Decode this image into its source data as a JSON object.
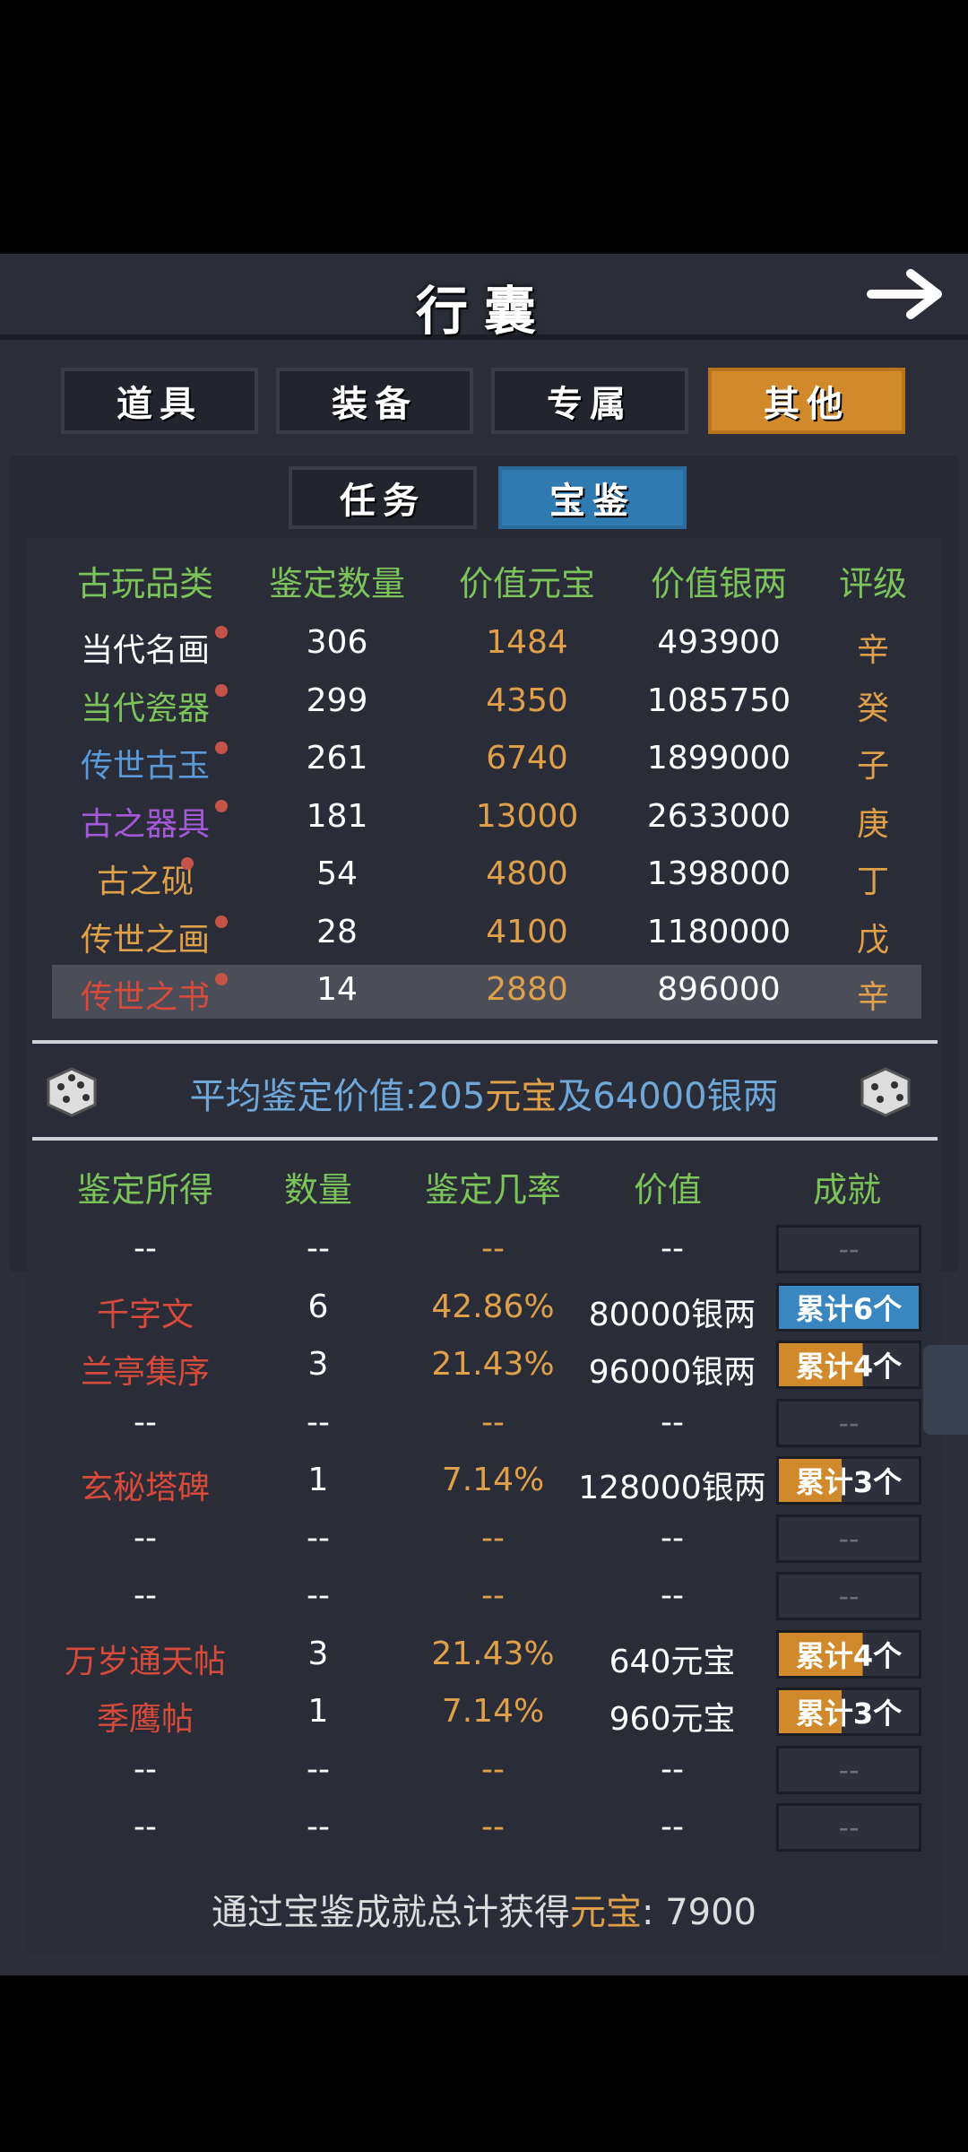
{
  "header": {
    "title": "行囊"
  },
  "tabs": [
    {
      "label": "道具",
      "active": false
    },
    {
      "label": "装备",
      "active": false
    },
    {
      "label": "专属",
      "active": false
    },
    {
      "label": "其他",
      "active": true
    }
  ],
  "subtabs": [
    {
      "label": "任务",
      "active": false
    },
    {
      "label": "宝鉴",
      "active": true
    }
  ],
  "antique_table": {
    "headers": [
      "古玩品类",
      "鉴定数量",
      "价值元宝",
      "价值银两",
      "评级"
    ],
    "rows": [
      {
        "name": "当代名画",
        "name_color": "#ffffff",
        "count": "306",
        "yuanbao": "1484",
        "silver": "493900",
        "grade": "辛"
      },
      {
        "name": "当代瓷器",
        "name_color": "#7cc45a",
        "count": "299",
        "yuanbao": "4350",
        "silver": "1085750",
        "grade": "癸"
      },
      {
        "name": "传世古玉",
        "name_color": "#5a9ad8",
        "count": "261",
        "yuanbao": "6740",
        "silver": "1899000",
        "grade": "子"
      },
      {
        "name": "古之器具",
        "name_color": "#a45ad8",
        "count": "181",
        "yuanbao": "13000",
        "silver": "2633000",
        "grade": "庚"
      },
      {
        "name": "古之砚",
        "name_color": "#e0a04a",
        "count": "54",
        "yuanbao": "4800",
        "silver": "1398000",
        "grade": "丁"
      },
      {
        "name": "传世之画",
        "name_color": "#e0a04a",
        "count": "28",
        "yuanbao": "4100",
        "silver": "1180000",
        "grade": "戊"
      },
      {
        "name": "传世之书",
        "name_color": "#d84a3a",
        "count": "14",
        "yuanbao": "2880",
        "silver": "896000",
        "grade": "辛"
      }
    ]
  },
  "average": {
    "prefix": "平均鉴定价值:",
    "yuanbao_amount": "205",
    "yuanbao_unit": "元宝",
    "joiner": "及",
    "silver": "64000银两"
  },
  "results_table": {
    "headers": [
      "鉴定所得",
      "数量",
      "鉴定几率",
      "价值",
      "成就"
    ],
    "rows": [
      {
        "name": "--",
        "count": "--",
        "rate": "--",
        "value": "--",
        "ach": "--",
        "ach_style": "empty"
      },
      {
        "name": "千字文",
        "count": "6",
        "rate": "42.86%",
        "value": "80000银两",
        "ach": "累计6个",
        "ach_style": "blue"
      },
      {
        "name": "兰亭集序",
        "count": "3",
        "rate": "21.43%",
        "value": "96000银两",
        "ach": "累计4个",
        "ach_style": "partial2"
      },
      {
        "name": "--",
        "count": "--",
        "rate": "--",
        "value": "--",
        "ach": "--",
        "ach_style": "empty"
      },
      {
        "name": "玄秘塔碑",
        "count": "1",
        "rate": "7.14%",
        "value": "128000银两",
        "ach": "累计3个",
        "ach_style": "partial"
      },
      {
        "name": "--",
        "count": "--",
        "rate": "--",
        "value": "--",
        "ach": "--",
        "ach_style": "empty"
      },
      {
        "name": "--",
        "count": "--",
        "rate": "--",
        "value": "--",
        "ach": "--",
        "ach_style": "empty"
      },
      {
        "name": "万岁通天帖",
        "count": "3",
        "rate": "21.43%",
        "value": "640元宝",
        "ach": "累计4个",
        "ach_style": "partial2"
      },
      {
        "name": "季鹰帖",
        "count": "1",
        "rate": "7.14%",
        "value": "960元宝",
        "ach": "累计3个",
        "ach_style": "partial"
      },
      {
        "name": "--",
        "count": "--",
        "rate": "--",
        "value": "--",
        "ach": "--",
        "ach_style": "empty"
      },
      {
        "name": "--",
        "count": "--",
        "rate": "--",
        "value": "--",
        "ach": "--",
        "ach_style": "empty"
      }
    ]
  },
  "footer": {
    "prefix": "通过宝鉴成就总计获得",
    "currency": "元宝",
    "value": ": 7900"
  }
}
